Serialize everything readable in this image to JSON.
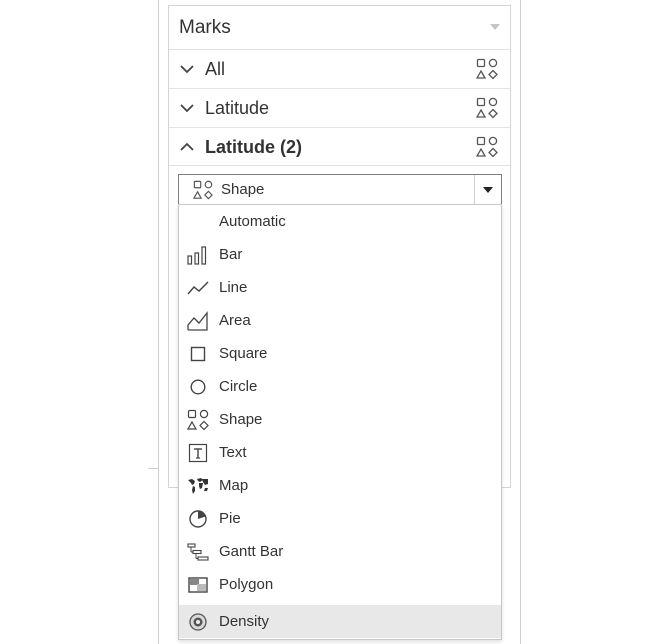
{
  "marks_panel": {
    "title": "Marks",
    "cards": [
      {
        "label": "All",
        "expanded": false,
        "bold": false
      },
      {
        "label": "Latitude",
        "expanded": false,
        "bold": false
      },
      {
        "label": "Latitude (2)",
        "expanded": true,
        "bold": true
      }
    ]
  },
  "mark_type_dropdown": {
    "selected": "Shape",
    "icon": "shape-icon"
  },
  "mark_type_menu": {
    "selected_item": "Density",
    "items": [
      {
        "label": "Automatic",
        "icon": ""
      },
      {
        "label": "Bar",
        "icon": "bar-icon"
      },
      {
        "label": "Line",
        "icon": "line-icon"
      },
      {
        "label": "Area",
        "icon": "area-icon"
      },
      {
        "label": "Square",
        "icon": "square-icon"
      },
      {
        "label": "Circle",
        "icon": "circle-icon"
      },
      {
        "label": "Shape",
        "icon": "shape-icon"
      },
      {
        "label": "Text",
        "icon": "text-icon"
      },
      {
        "label": "Map",
        "icon": "map-icon"
      },
      {
        "label": "Pie",
        "icon": "pie-icon"
      },
      {
        "label": "Gantt Bar",
        "icon": "gantt-bar-icon"
      },
      {
        "label": "Polygon",
        "icon": "polygon-icon"
      },
      {
        "label": "Density",
        "icon": "density-icon"
      }
    ]
  }
}
